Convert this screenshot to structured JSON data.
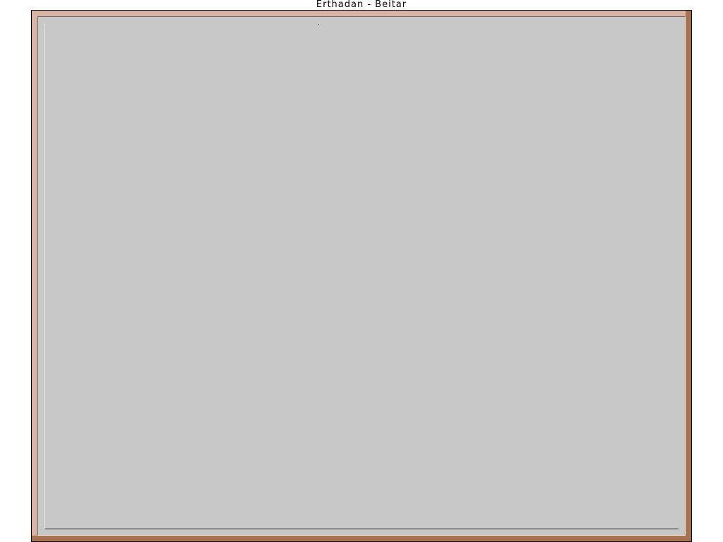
{
  "window": {
    "title": "Erthadan - Beitar"
  },
  "colors": {
    "frame_dark": "#a8714d",
    "frame_light": "#d8b3a3",
    "panel": "#c8c8c8"
  }
}
